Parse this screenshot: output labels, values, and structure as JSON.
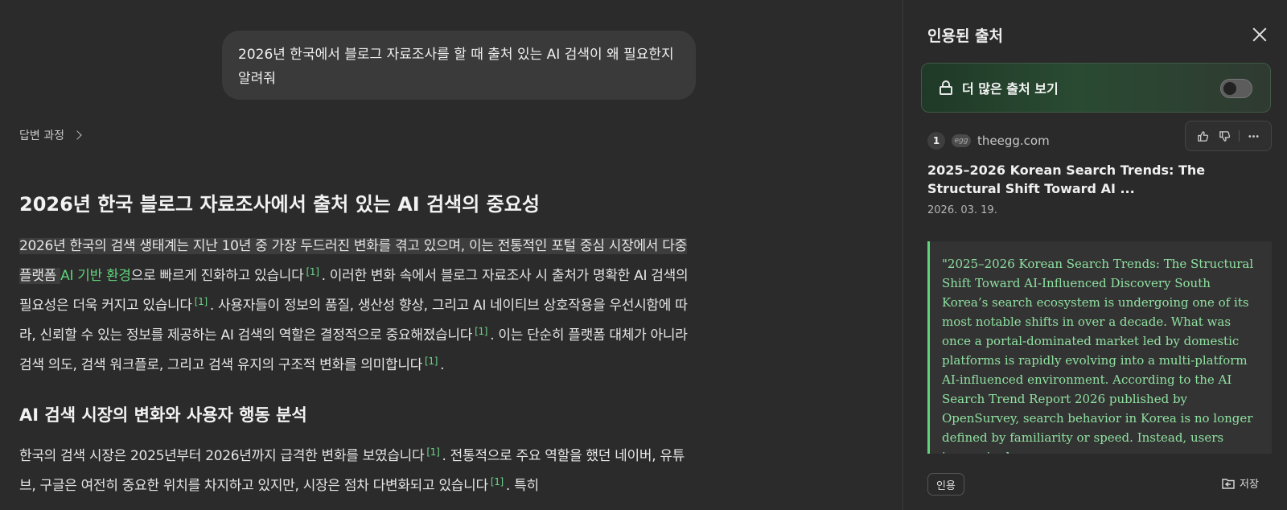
{
  "user_message": "2026년 한국에서 블로그 자료조사를 할 때 출처 있는 AI 검색이 왜 필요한지 알려줘",
  "answer_process_label": "답변 과정",
  "answer": {
    "title": "2026년 한국 블로그 자료조사에서 출처 있는 AI 검색의 중요성",
    "p1": {
      "a": "2026년 한국의 검색 생태계는 지난 10년 중 가장 두드러진 변화를 겪고 있으며, 이는 전통적인 포털 중심 시장에서 다중 플랫폼 ",
      "link": "AI 기반 환경",
      "b": "으로 빠르게 진화하고 있습니다",
      "c": ". 이러한 변화 속에서 블로그 자료조사 시 출처가 명확한 AI 검색의 필요성은 더욱 커지고 있습니다",
      "d": ". 사용자들이 정보의 품질, 생산성 향상, 그리고 AI 네이티브 상호작용을 우선시함에 따라, 신뢰할 수 있는 정보를 제공하는 AI 검색의 역할은 결정적으로 중요해졌습니다",
      "e": ". 이는 단순히 플랫폼 대체가 아니라 검색 의도, 검색 워크플로, 그리고 검색 유지의 구조적 변화를 의미합니다",
      "f": "."
    },
    "h2": "AI 검색 시장의 변화와 사용자 행동 분석",
    "p2": {
      "a": "한국의 검색 시장은 2025년부터 2026년까지 급격한 변화를 보였습니다",
      "b": ". 전통적으로 주요 역할을 했던 네이버, 유튜브, 구글은 여전히 중요한 위치를 차지하고 있지만, 시장은 점차 다변화되고 있습니다",
      "c": ". 특히"
    },
    "cite_label": "[1]"
  },
  "sidebar": {
    "title": "인용된 출처",
    "more_sources_label": "더 많은 출처 보기",
    "more_sources_enabled": false,
    "source": {
      "number": "1",
      "favicon_text": "egg",
      "domain": "theegg.com",
      "title": "2025–2026 Korean Search Trends: The Structural Shift Toward AI ...",
      "date": "2026. 03. 19.",
      "quote": "\"2025–2026 Korean Search Trends: The Structural Shift Toward AI-Influenced Discovery South Korea’s search ecosystem is undergoing one of its most notable shifts in over a decade. What was once a portal-dominated market led by domestic platforms is rapidly evolving into a multi-platform AI-influenced environment. According to the AI Search Trend Report 2026 published by OpenSurvey, search behavior in Korea is no longer defined by familiarity or speed. Instead, users increasingly…"
    },
    "cite_button": "인용",
    "save_button": "저장"
  },
  "colors": {
    "accent_green": "#5fd37a",
    "quote_text": "#8fe0a0",
    "background": "#2b2b2b"
  }
}
